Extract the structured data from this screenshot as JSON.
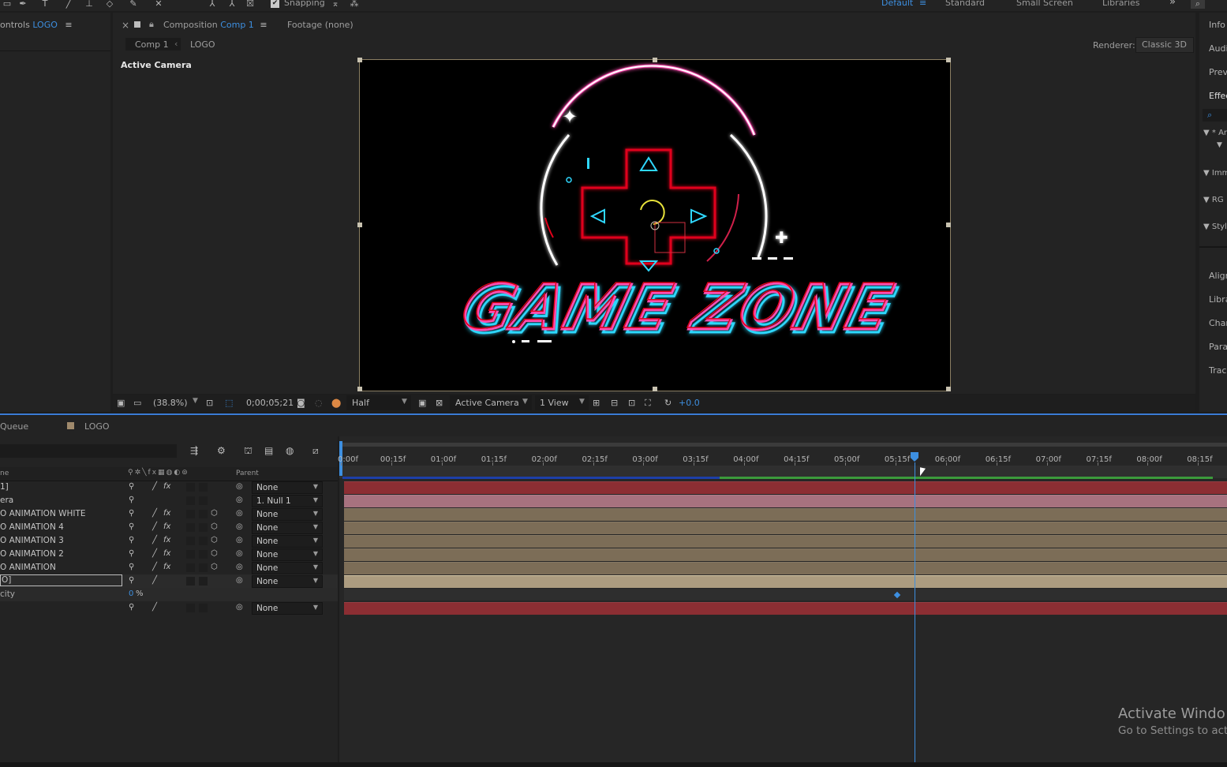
{
  "toolbar": {
    "snapping_label": "Snapping",
    "workspaces": [
      {
        "label": "Default",
        "active": true
      },
      {
        "label": "Standard",
        "active": false
      },
      {
        "label": "Small Screen",
        "active": false
      },
      {
        "label": "Libraries",
        "active": false
      }
    ],
    "more_glyph": "»"
  },
  "effect_controls": {
    "prefix": "ontrols",
    "layer": "LOGO"
  },
  "composition_panel": {
    "close_glyph": "×",
    "title_prefix": "Composition",
    "comp_name": "Comp 1",
    "footage_tab": "Footage (none)",
    "breadcrumb": [
      "Comp 1",
      "LOGO"
    ],
    "renderer_label": "Renderer:",
    "renderer_value": "Classic 3D",
    "view_label": "Active Camera"
  },
  "artwork": {
    "logo_text": "GAME ZONE",
    "colors": {
      "pink": "#ff4fb3",
      "cyan": "#2fd8ff",
      "red": "#e0001a",
      "white": "#ffffff",
      "yellow": "#e8e23a"
    }
  },
  "comp_footer": {
    "zoom": "(38.8%)",
    "timecode": "0;00;05;21",
    "resolution": "Half",
    "view": "Active Camera",
    "views": "1 View",
    "exposure": "+0.0"
  },
  "right_panel": {
    "items": [
      "Info",
      "Audi",
      "Prev",
      "Effec",
      "Ar",
      "Imm",
      "RG",
      "Styl",
      "Align",
      "Libra",
      "Char",
      "Para",
      "Track"
    ]
  },
  "timeline": {
    "queue_tab": "Queue",
    "comp_tab": "LOGO",
    "columns": {
      "name": "ne",
      "parent": "Parent"
    },
    "current_time_fraction": 0.6477,
    "ticks": [
      "0:00f",
      "00:15f",
      "01:00f",
      "01:15f",
      "02:00f",
      "02:15f",
      "03:00f",
      "03:15f",
      "04:00f",
      "04:15f",
      "05:00f",
      "05:15f",
      "06:00f",
      "06:15f",
      "07:00f",
      "07:15f",
      "08:00f",
      "08:15f"
    ],
    "layers": [
      {
        "name": "1]",
        "fx": true,
        "cube": false,
        "parent": "None",
        "color": "#8c2e33"
      },
      {
        "name": "era",
        "fx": false,
        "cube": false,
        "parent": "1. Null 1",
        "color": "#a7727f"
      },
      {
        "name": "O ANIMATION WHITE",
        "fx": true,
        "cube": true,
        "parent": "None",
        "color": "#7c6d57"
      },
      {
        "name": "O ANIMATION 4",
        "fx": true,
        "cube": true,
        "parent": "None",
        "color": "#7c6d57"
      },
      {
        "name": "O ANIMATION 3",
        "fx": true,
        "cube": true,
        "parent": "None",
        "color": "#7c6d57"
      },
      {
        "name": "O ANIMATION 2",
        "fx": true,
        "cube": true,
        "parent": "None",
        "color": "#7c6d57"
      },
      {
        "name": "O ANIMATION",
        "fx": true,
        "cube": true,
        "parent": "None",
        "color": "#7c6d57"
      },
      {
        "name": "O]",
        "fx": false,
        "cube": false,
        "parent": "None",
        "color": "#ac9c80",
        "selected": true
      }
    ],
    "property": {
      "name": "city",
      "value": "0",
      "unit": "%"
    },
    "last_layer": {
      "name": "",
      "parent": "None",
      "color": "#8c2e33"
    }
  },
  "watermark": {
    "title": "Activate Windo",
    "subtitle": "Go to Settings to act"
  }
}
